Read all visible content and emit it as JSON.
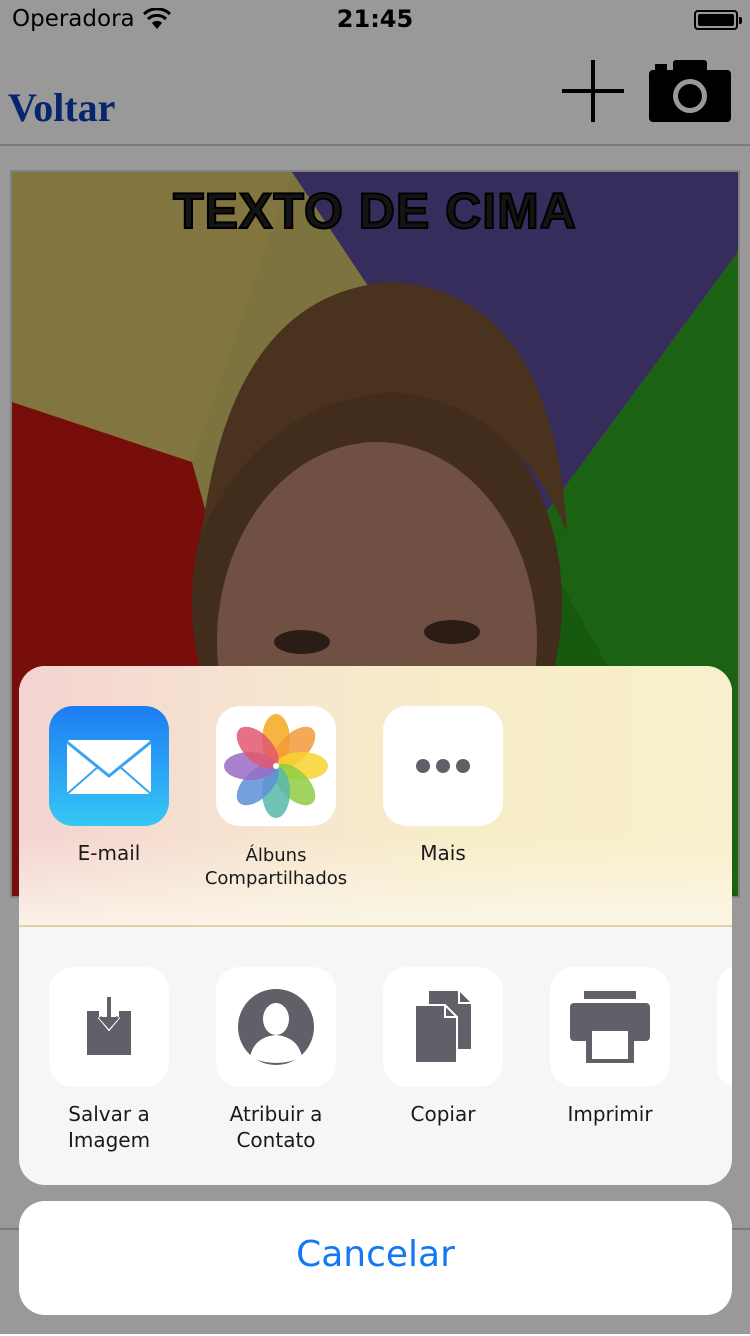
{
  "status_bar": {
    "carrier": "Operadora",
    "time": "21:45"
  },
  "nav": {
    "back_label": "Voltar"
  },
  "meme": {
    "top_text": "TEXTO DE CIMA"
  },
  "share_sheet": {
    "apps": [
      {
        "label": "E-mail",
        "icon": "mail-icon"
      },
      {
        "label_line1": "Álbuns",
        "label_line2": "Compartilhados",
        "icon": "photos-icon"
      },
      {
        "label": "Mais",
        "icon": "more-icon"
      }
    ],
    "actions": [
      {
        "label_line1": "Salvar a",
        "label_line2": "Imagem",
        "icon": "save-image-icon"
      },
      {
        "label_line1": "Atribuir a",
        "label_line2": "Contato",
        "icon": "contact-icon"
      },
      {
        "label": "Copiar",
        "icon": "copy-icon"
      },
      {
        "label": "Imprimir",
        "icon": "print-icon"
      }
    ],
    "cancel_label": "Cancelar"
  },
  "colors": {
    "accent": "#1278f5",
    "back_link": "#0a3fb7"
  }
}
